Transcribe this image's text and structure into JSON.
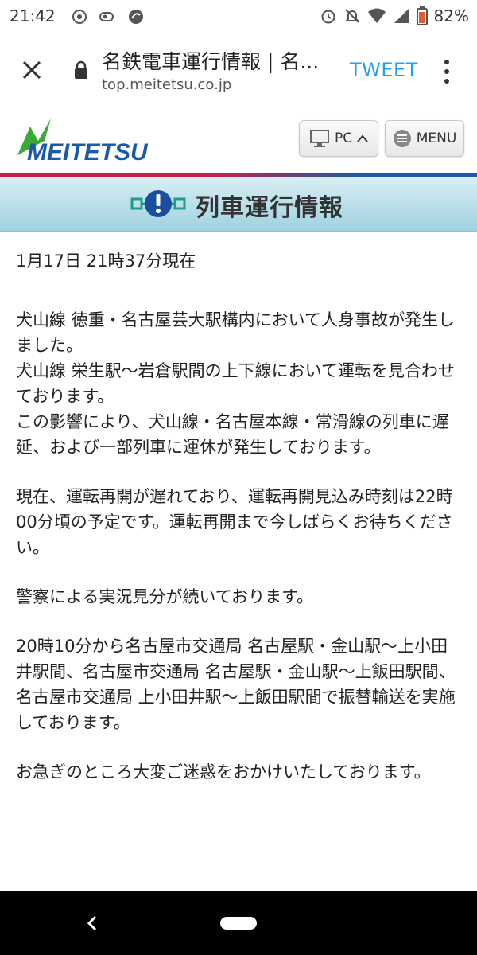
{
  "status_bar": {
    "time": "21:42",
    "battery": "82%"
  },
  "browser": {
    "page_title": "名鉄電車運行情報 | 名...",
    "url": "top.meitetsu.co.jp",
    "tweet_label": "TWEET"
  },
  "site": {
    "logo_text": "MEITETSU",
    "pc_button": "PC",
    "menu_button": "MENU"
  },
  "banner": {
    "title": "列車運行情報"
  },
  "timestamp": "1月17日 21時37分現在",
  "paragraphs": [
    "犬山線 徳重・名古屋芸大駅構内において人身事故が発生しました。\n犬山線 栄生駅〜岩倉駅間の上下線において運転を見合わせております。\nこの影響により、犬山線・名古屋本線・常滑線の列車に遅延、および一部列車に運休が発生しております。",
    "現在、運転再開が遅れており、運転再開見込み時刻は22時00分頃の予定です。運転再開まで今しばらくお待ちください。",
    "警察による実況見分が続いております。",
    "20時10分から名古屋市交通局 名古屋駅・金山駅〜上小田井駅間、名古屋市交通局 名古屋駅・金山駅〜上飯田駅間、名古屋市交通局 上小田井駅〜上飯田駅間で振替輸送を実施しております。",
    "お急ぎのところ大変ご迷惑をおかけいたしております。"
  ],
  "colors": {
    "tweet": "#1da1f2",
    "logo_green": "#3aa935",
    "logo_blue": "#1a5aa6",
    "accent_red": "#c4214a",
    "banner_cyan": "#9fd2e0"
  }
}
